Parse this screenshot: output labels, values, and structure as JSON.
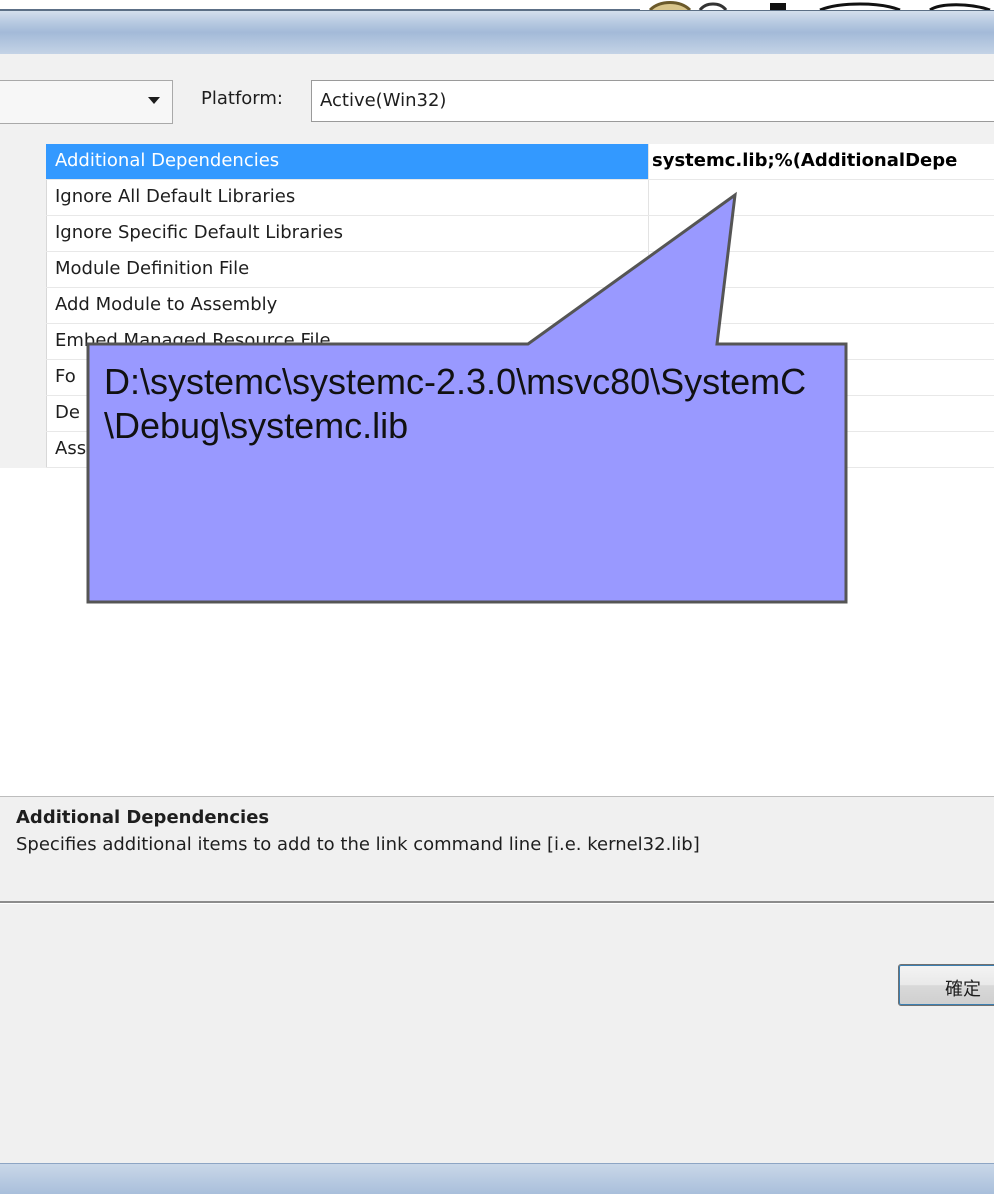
{
  "toolbar": {
    "platform_label": "Platform:",
    "platform_value": "Active(Win32)"
  },
  "properties": [
    {
      "name": "Additional Dependencies",
      "value": "systemc.lib;%(AdditionalDepe",
      "selected": true
    },
    {
      "name": "Ignore All Default Libraries",
      "value": ""
    },
    {
      "name": "Ignore Specific Default Libraries",
      "value": ""
    },
    {
      "name": "Module Definition File",
      "value": ""
    },
    {
      "name": "Add Module to Assembly",
      "value": ""
    },
    {
      "name": "Embed Managed Resource File",
      "value": ""
    },
    {
      "name": "Fo",
      "value": ""
    },
    {
      "name": "De",
      "value": ""
    },
    {
      "name": "Ass",
      "value": ""
    }
  ],
  "callout": {
    "text": "D:\\systemc\\systemc-2.3.0\\msvc80\\SystemC\\Debug\\systemc.lib",
    "fill": "#9999ff",
    "border": "#555555"
  },
  "description": {
    "title": "Additional Dependencies",
    "text": "Specifies additional items to add to the link command line [i.e. kernel32.lib]"
  },
  "buttons": {
    "ok_label": "確定"
  },
  "colors": {
    "selection": "#3399ff"
  },
  "icons": {
    "config_dropdown": "chevron-down-icon",
    "platform_dropdown": "chevron-down-icon"
  }
}
